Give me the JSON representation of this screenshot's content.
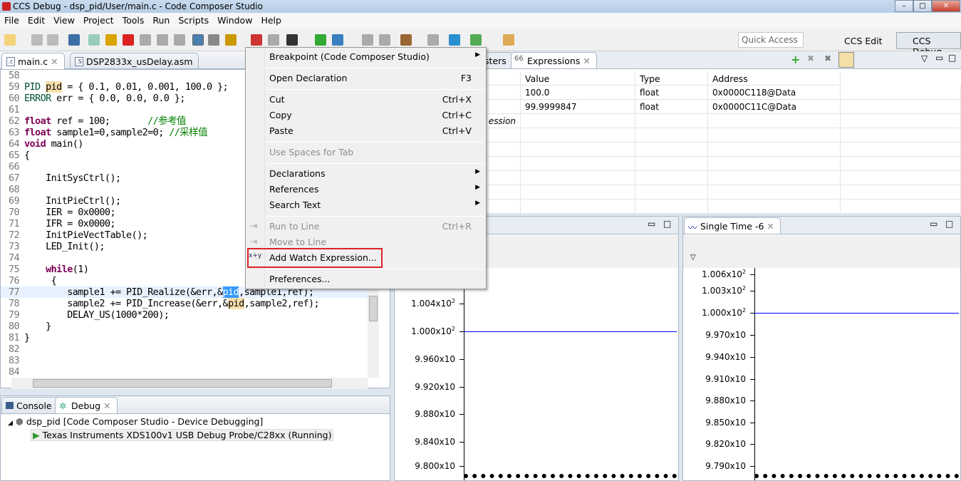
{
  "window": {
    "title": "CCS Debug - dsp_pid/User/main.c - Code Composer Studio"
  },
  "menubar": [
    "File",
    "Edit",
    "View",
    "Project",
    "Tools",
    "Run",
    "Scripts",
    "Window",
    "Help"
  ],
  "toolbar": {
    "quick_access": "Quick Access",
    "perspectives": [
      "CCS Edit",
      "CCS Debug"
    ]
  },
  "editor": {
    "tabs": [
      "main.c",
      "DSP2833x_usDelay.asm"
    ],
    "lines": [
      {
        "n": "58",
        "code": ""
      },
      {
        "n": "59",
        "code": "PID pid = { 0.1, 0.01, 0.001, 100.0 };"
      },
      {
        "n": "60",
        "code": "ERROR err = { 0.0, 0.0, 0.0 };"
      },
      {
        "n": "61",
        "code": ""
      },
      {
        "n": "62",
        "code": "float ref = 100;       //参考值"
      },
      {
        "n": "63",
        "code": "float sample1=0,sample2=0; //采样值"
      },
      {
        "n": "64",
        "code": "void main()"
      },
      {
        "n": "65",
        "code": "{"
      },
      {
        "n": "66",
        "code": ""
      },
      {
        "n": "67",
        "code": "    InitSysCtrl();"
      },
      {
        "n": "68",
        "code": ""
      },
      {
        "n": "69",
        "code": "    InitPieCtrl();"
      },
      {
        "n": "70",
        "code": "    IER = 0x0000;"
      },
      {
        "n": "71",
        "code": "    IFR = 0x0000;"
      },
      {
        "n": "72",
        "code": "    InitPieVectTable();"
      },
      {
        "n": "73",
        "code": "    LED_Init();"
      },
      {
        "n": "74",
        "code": ""
      },
      {
        "n": "75",
        "code": "    while(1)"
      },
      {
        "n": "76",
        "code": "     {"
      },
      {
        "n": "77",
        "code": "        sample1 += PID_Realize(&err,&pid,sample1,ref);"
      },
      {
        "n": "78",
        "code": "        sample2 += PID_Increase(&err,&pid,sample2,ref);"
      },
      {
        "n": "79",
        "code": "        DELAY_US(1000*200);"
      },
      {
        "n": "80",
        "code": "    }"
      },
      {
        "n": "81",
        "code": "}"
      },
      {
        "n": "82",
        "code": ""
      },
      {
        "n": "83",
        "code": ""
      },
      {
        "n": "84",
        "code": ""
      }
    ]
  },
  "context_menu": [
    {
      "label": "Breakpoint (Code Composer Studio)",
      "submenu": true
    },
    {
      "sep": true
    },
    {
      "label": "Open Declaration",
      "shortcut": "F3"
    },
    {
      "sep": true
    },
    {
      "label": "Cut",
      "shortcut": "Ctrl+X"
    },
    {
      "label": "Copy",
      "shortcut": "Ctrl+C"
    },
    {
      "label": "Paste",
      "shortcut": "Ctrl+V"
    },
    {
      "sep": true
    },
    {
      "label": "Use Spaces for Tab",
      "disabled": true
    },
    {
      "sep": true
    },
    {
      "label": "Declarations",
      "submenu": true
    },
    {
      "label": "References",
      "submenu": true
    },
    {
      "label": "Search Text",
      "submenu": true
    },
    {
      "sep": true
    },
    {
      "label": "Run to Line",
      "shortcut": "Ctrl+R",
      "disabled": true
    },
    {
      "label": "Move to Line",
      "disabled": true
    },
    {
      "label": "Add Watch Expression...",
      "highlighted": true
    },
    {
      "sep": true
    },
    {
      "label": "Preferences..."
    }
  ],
  "expressions": {
    "tabs": [
      "sters",
      "Expressions"
    ],
    "columns": [
      "Value",
      "Type",
      "Address"
    ],
    "rows": [
      {
        "value": "100.0",
        "type": "float",
        "address": "0x0000C118@Data"
      },
      {
        "value": "99.9999847",
        "type": "float",
        "address": "0x0000C11C@Data"
      }
    ],
    "add_new": "ession"
  },
  "graph_left": {
    "y_ticks": [
      {
        "m": "1.004x10",
        "e": "2"
      },
      {
        "m": "1.000x10",
        "e": "2"
      },
      {
        "m": "9.960x10",
        "e": ""
      },
      {
        "m": "9.920x10",
        "e": ""
      },
      {
        "m": "9.880x10",
        "e": ""
      },
      {
        "m": "9.840x10",
        "e": ""
      },
      {
        "m": "9.800x10",
        "e": ""
      }
    ],
    "value": 100.0,
    "line_color": "#0000ff"
  },
  "graph_right": {
    "title": "Single Time -6",
    "y_ticks": [
      {
        "m": "1.006x10",
        "e": "2"
      },
      {
        "m": "1.003x10",
        "e": "2"
      },
      {
        "m": "1.000x10",
        "e": "2"
      },
      {
        "m": "9.970x10",
        "e": ""
      },
      {
        "m": "9.940x10",
        "e": ""
      },
      {
        "m": "9.910x10",
        "e": ""
      },
      {
        "m": "9.880x10",
        "e": ""
      },
      {
        "m": "9.850x10",
        "e": ""
      },
      {
        "m": "9.820x10",
        "e": ""
      },
      {
        "m": "9.790x10",
        "e": ""
      }
    ],
    "value": 100.0,
    "line_color": "#0000ff"
  },
  "bottom": {
    "tabs": [
      "Console",
      "Debug"
    ],
    "tree": [
      "dsp_pid [Code Composer Studio - Device Debugging]",
      "Texas Instruments XDS100v1 USB Debug Probe/C28xx (Running)"
    ]
  }
}
